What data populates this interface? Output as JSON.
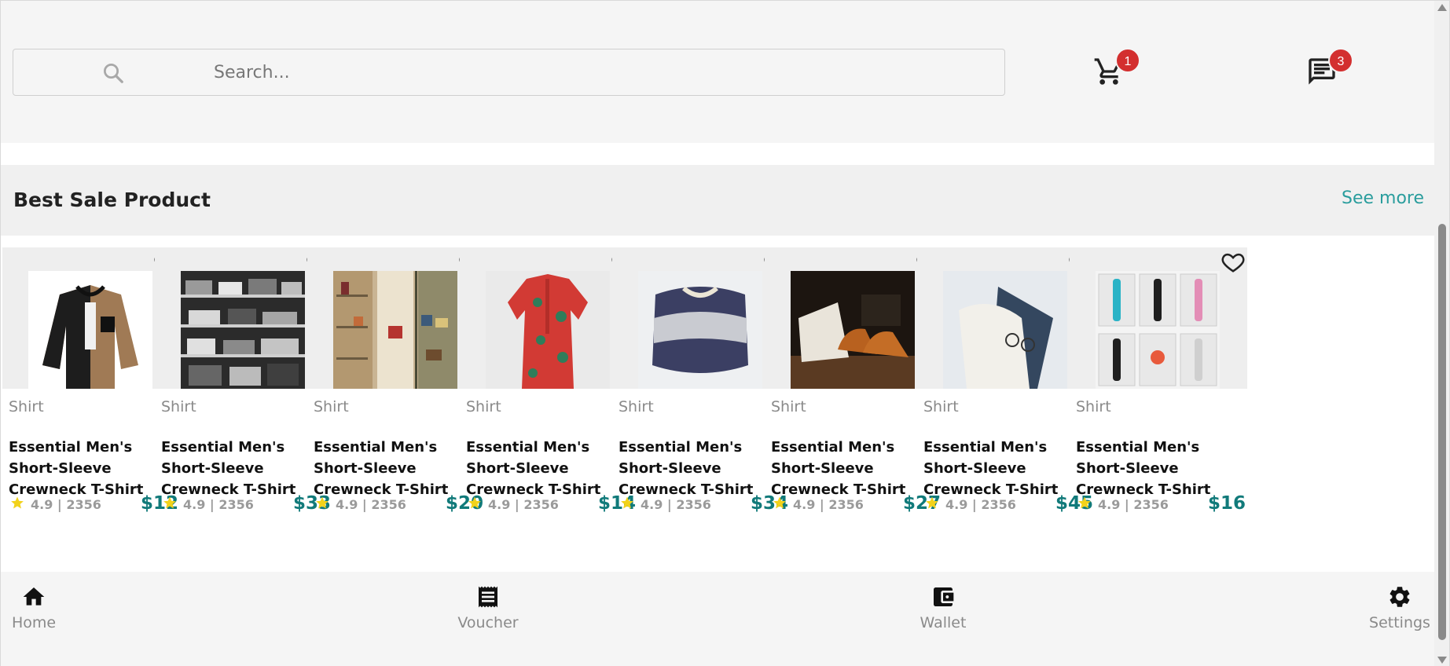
{
  "header": {
    "search_placeholder": "Search...",
    "cart_badge": "1",
    "chat_badge": "3"
  },
  "section": {
    "title": "Best Sale Product",
    "see_more": "See more"
  },
  "products": [
    {
      "category": "Shirt",
      "name": "Essential Men's Short-Sleeve Crewneck T-Shirt",
      "rating": "4.9 | 2356",
      "price": "$12"
    },
    {
      "category": "Shirt",
      "name": "Essential Men's Short-Sleeve Crewneck T-Shirt",
      "rating": "4.9 | 2356",
      "price": "$33"
    },
    {
      "category": "Shirt",
      "name": "Essential Men's Short-Sleeve Crewneck T-Shirt",
      "rating": "4.9 | 2356",
      "price": "$20"
    },
    {
      "category": "Shirt",
      "name": "Essential Men's Short-Sleeve Crewneck T-Shirt",
      "rating": "4.9 | 2356",
      "price": "$14"
    },
    {
      "category": "Shirt",
      "name": "Essential Men's Short-Sleeve Crewneck T-Shirt",
      "rating": "4.9 | 2356",
      "price": "$34"
    },
    {
      "category": "Shirt",
      "name": "Essential Men's Short-Sleeve Crewneck T-Shirt",
      "rating": "4.9 | 2356",
      "price": "$27"
    },
    {
      "category": "Shirt",
      "name": "Essential Men's Short-Sleeve Crewneck T-Shirt",
      "rating": "4.9 | 2356",
      "price": "$45"
    },
    {
      "category": "Shirt",
      "name": "Essential Men's Short-Sleeve Crewneck T-Shirt",
      "rating": "4.9 | 2356",
      "price": "$16"
    }
  ],
  "nav": [
    {
      "label": "Home",
      "icon": "home-icon"
    },
    {
      "label": "Voucher",
      "icon": "receipt-icon"
    },
    {
      "label": "Wallet",
      "icon": "wallet-icon"
    },
    {
      "label": "Settings",
      "icon": "gear-icon"
    }
  ],
  "colors": {
    "accent": "#2a9d9d",
    "price": "#117a7a",
    "badge": "#d32f2f",
    "star": "#f2d21b"
  }
}
